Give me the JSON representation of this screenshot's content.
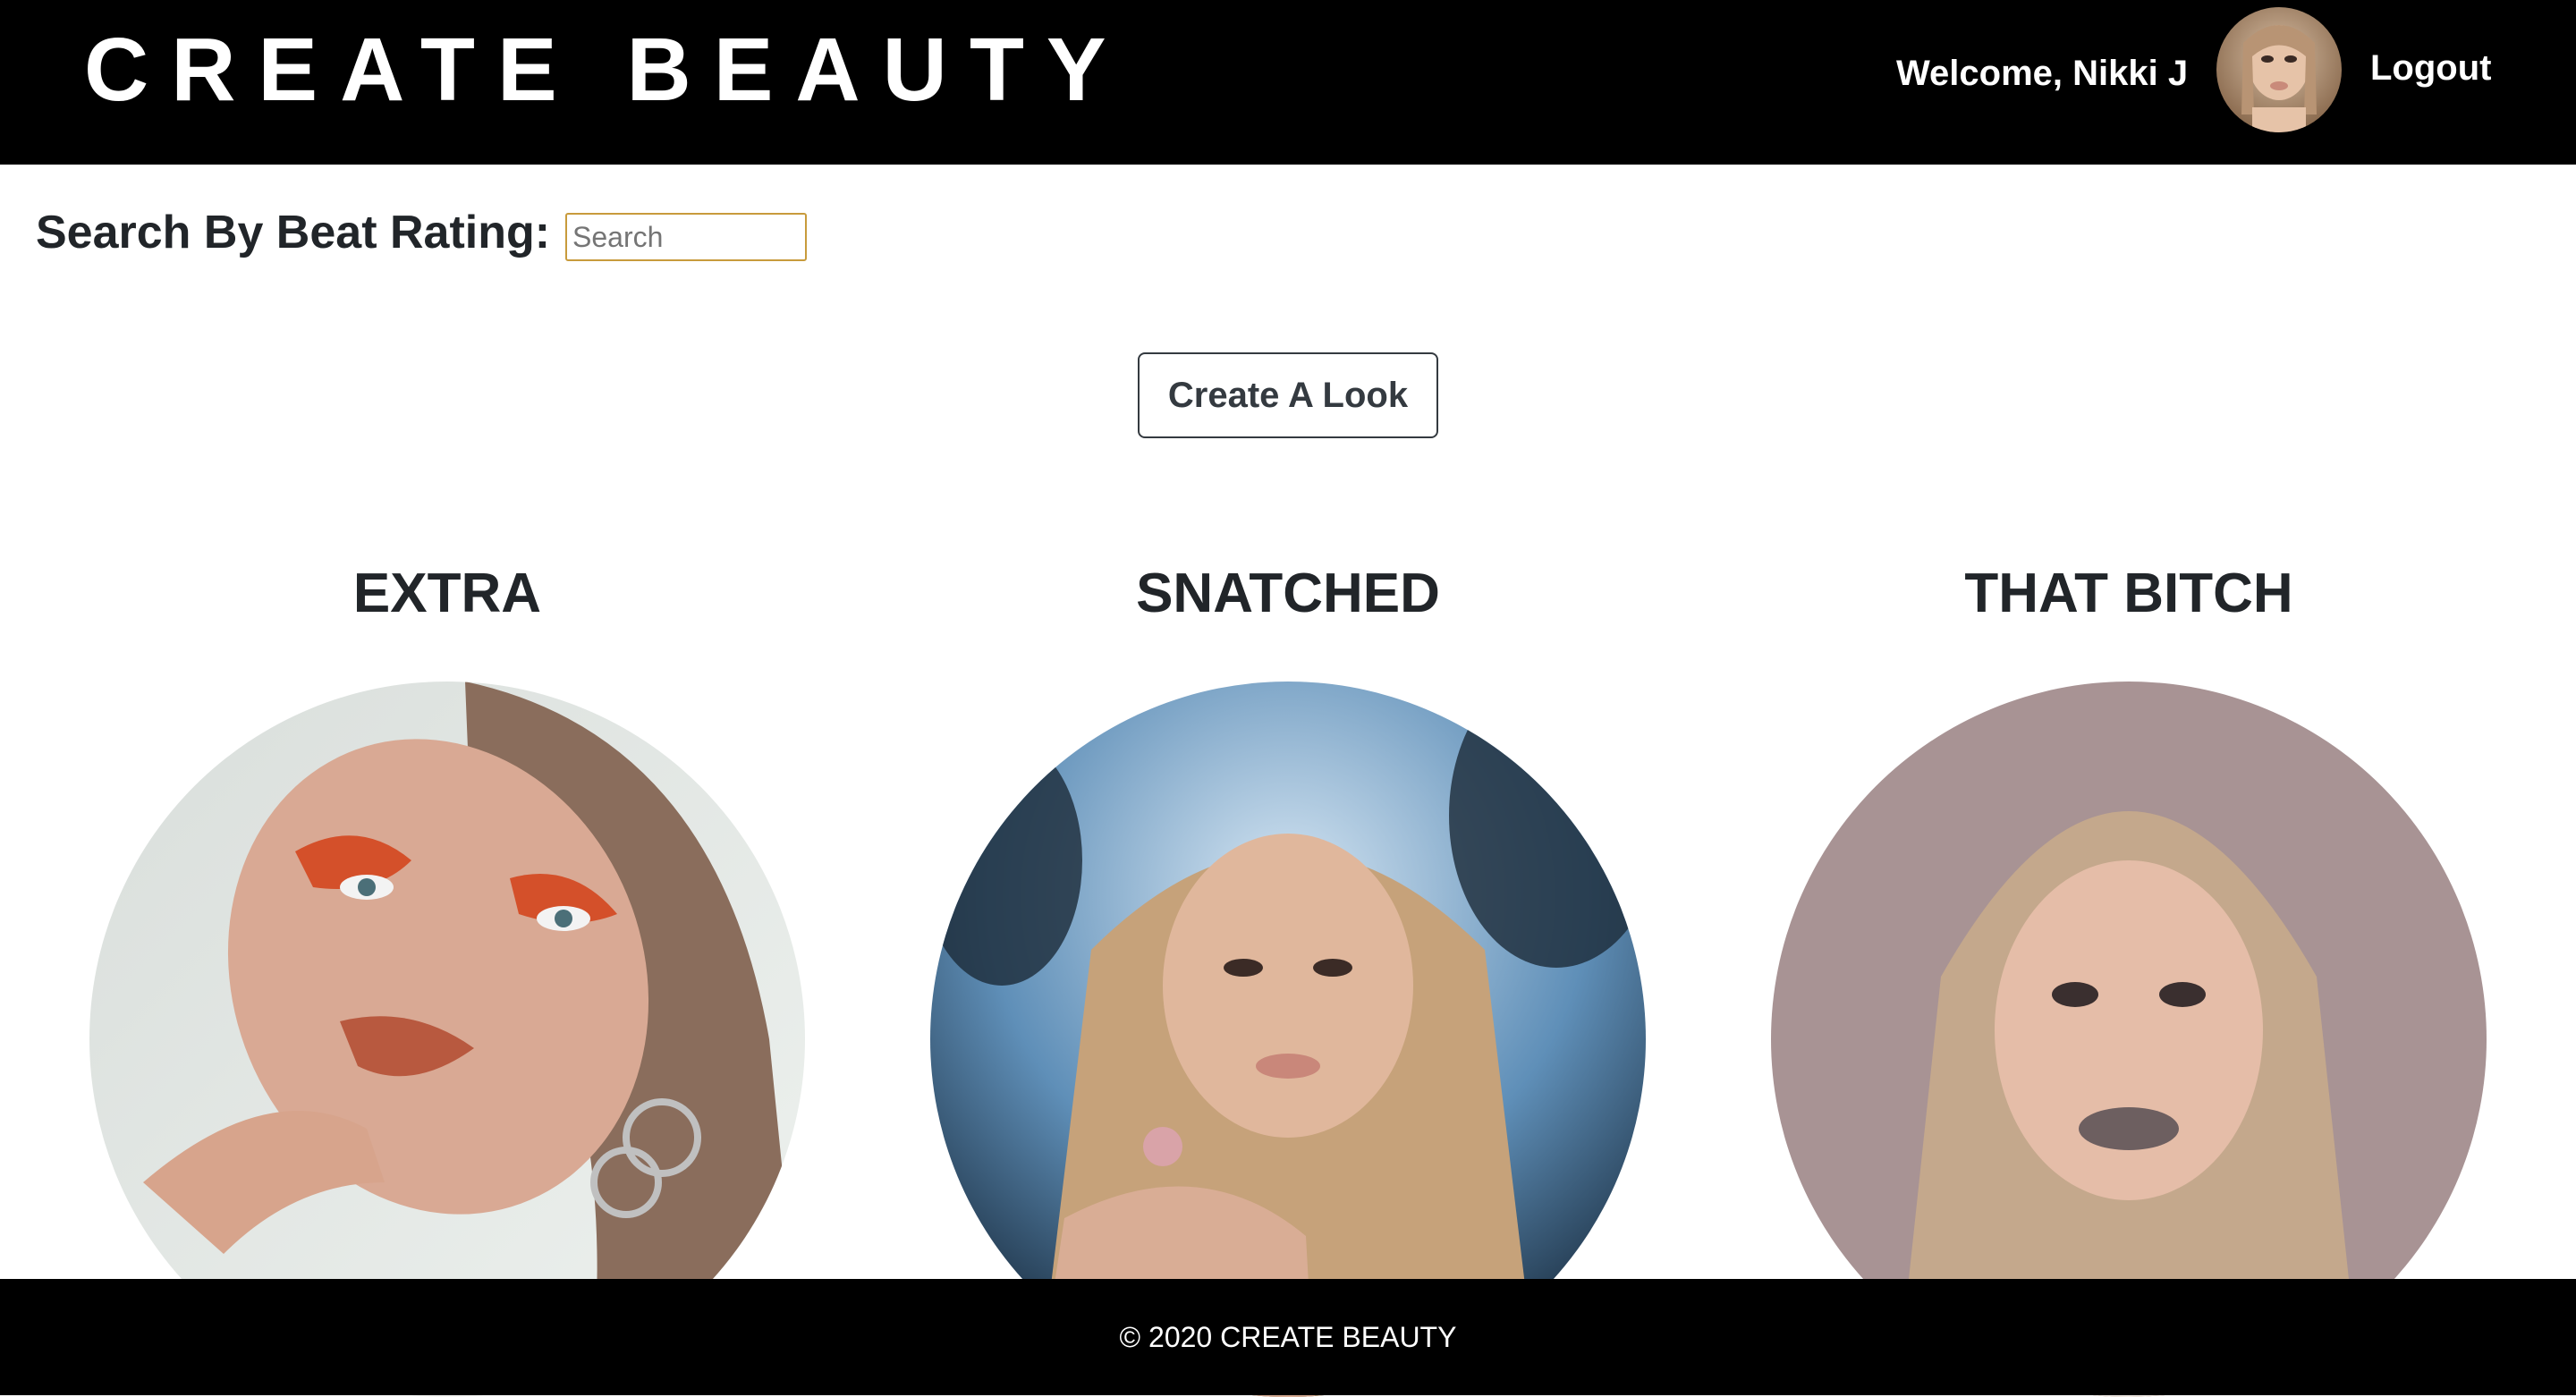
{
  "header": {
    "brand": "CREATE BEAUTY",
    "welcome": "Welcome, Nikki J",
    "logout": "Logout"
  },
  "search": {
    "label": "Search By Beat Rating:",
    "placeholder": "Search",
    "value": ""
  },
  "actions": {
    "create_look": "Create A Look"
  },
  "looks": [
    {
      "title": "EXTRA"
    },
    {
      "title": "SNATCHED"
    },
    {
      "title": "THAT BITCH"
    }
  ],
  "footer": {
    "copyright": "© 2020 CREATE BEAUTY"
  },
  "colors": {
    "header_bg": "#000000",
    "search_border": "#c89b3c",
    "text": "#212529"
  }
}
